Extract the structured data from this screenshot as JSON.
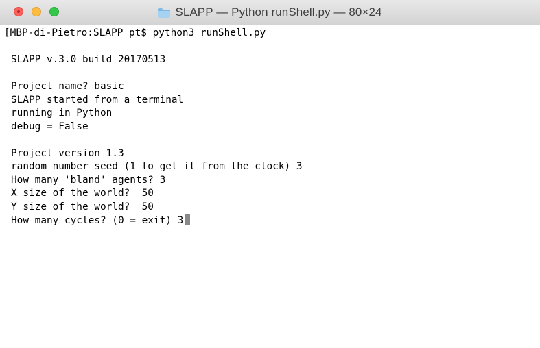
{
  "window": {
    "title": "SLAPP — Python runShell.py — 80×24",
    "title_icon": "folder-icon",
    "controls": {
      "close": "close-icon",
      "minimize": "minimize-icon",
      "zoom": "zoom-icon"
    }
  },
  "terminal": {
    "lines": [
      "[MBP-di-Pietro:SLAPP pt$ python3 runShell.py",
      "",
      "SLAPP v.3.0 build 20170513",
      "",
      "Project name? basic",
      "SLAPP started from a terminal",
      "running in Python",
      "debug = False",
      "",
      "Project version 1.3",
      "random number seed (1 to get it from the clock) 3",
      "How many 'bland' agents? 3",
      "X size of the world?  50",
      "Y size of the world?  50",
      "How many cycles? (0 = exit) 3"
    ]
  },
  "colors": {
    "titlebar_top": "#e9e8e9",
    "titlebar_bottom": "#d4d3d4",
    "close": "#fc605b",
    "minimize": "#fdbc40",
    "zoom": "#34c84a",
    "cursor": "#8a8a8a",
    "text": "#000000",
    "background": "#ffffff"
  }
}
